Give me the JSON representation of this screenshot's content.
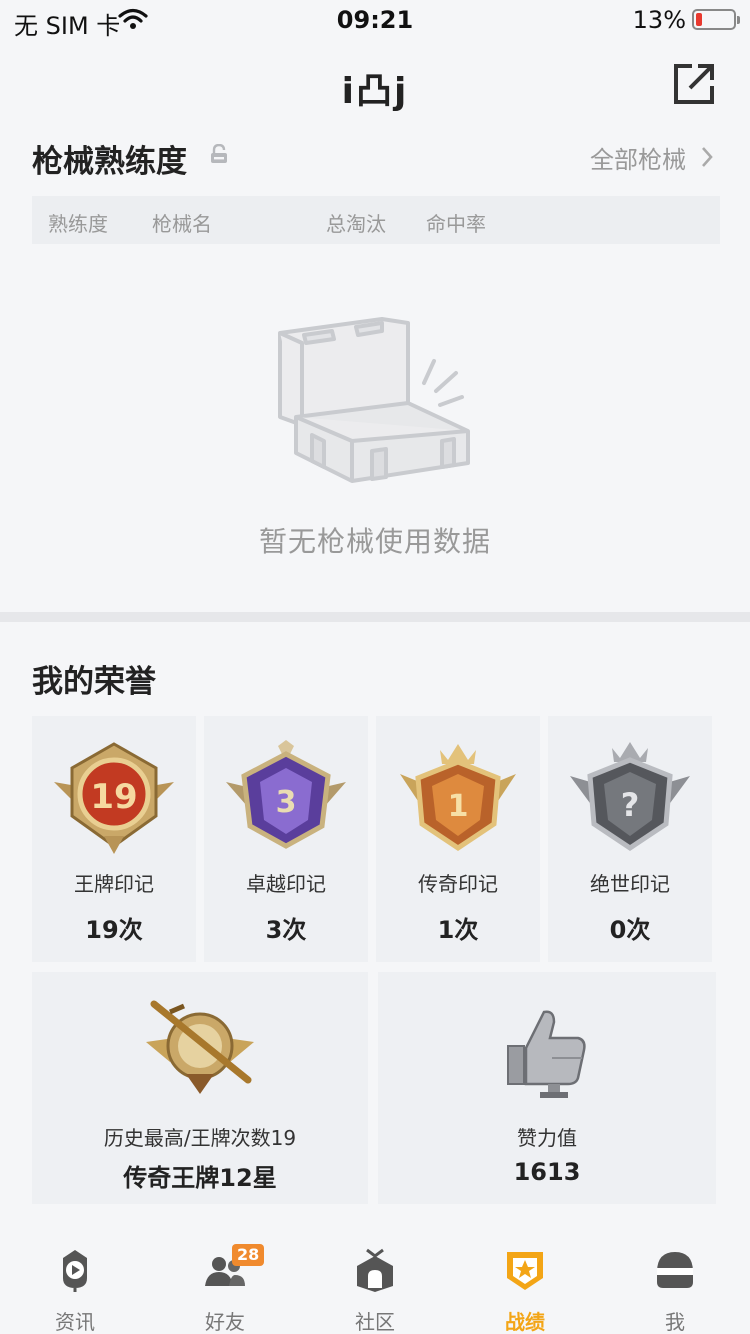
{
  "status_bar": {
    "carrier": "无 SIM 卡",
    "time": "09:21",
    "battery": "13%"
  },
  "header": {
    "title": "i凸j"
  },
  "weapon_section": {
    "title": "枪械熟练度",
    "all_link": "全部枪械",
    "columns": [
      "熟练度",
      "枪械名",
      "总淘汰",
      "命中率"
    ],
    "empty_text": "暂无枪械使用数据"
  },
  "honor_section": {
    "title": "我的荣誉",
    "badges": [
      {
        "name": "王牌印记",
        "count": "19次",
        "number": "19",
        "color": "#c23a22"
      },
      {
        "name": "卓越印记",
        "count": "3次",
        "number": "3",
        "color": "#6b4bb8"
      },
      {
        "name": "传奇印记",
        "count": "1次",
        "number": "1",
        "color": "#d07a2a"
      },
      {
        "name": "绝世印记",
        "count": "0次",
        "number": "?",
        "color": "#6d6f75"
      }
    ],
    "summary": [
      {
        "label": "历史最高/王牌次数19",
        "value": "传奇王牌12星"
      },
      {
        "label": "赞力值",
        "value": "1613"
      }
    ]
  },
  "tabbar": {
    "tabs": [
      {
        "label": "资讯",
        "icon": "news-play-icon"
      },
      {
        "label": "好友",
        "icon": "friends-icon",
        "badge": "28"
      },
      {
        "label": "社区",
        "icon": "community-icon"
      },
      {
        "label": "战绩",
        "icon": "record-shield-icon",
        "active": true
      },
      {
        "label": "我",
        "icon": "helmet-icon"
      }
    ]
  },
  "colors": {
    "accent": "#f3a516",
    "badge": "#f08a2e",
    "battery_low": "#e8392f"
  }
}
